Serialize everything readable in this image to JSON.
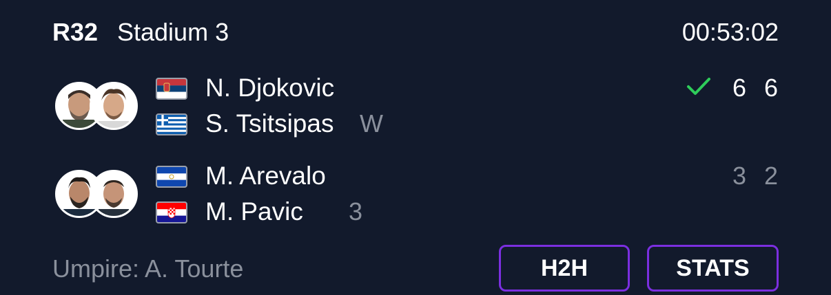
{
  "match": {
    "round": "R32",
    "court": "Stadium 3",
    "duration": "00:53:02"
  },
  "teams": [
    {
      "players": [
        {
          "name": "N. Djokovic",
          "flag_icon": "serbia-flag-icon"
        },
        {
          "name": "S. Tsitsipas",
          "flag_icon": "greece-flag-icon",
          "seed": "W"
        }
      ],
      "sets": [
        "6",
        "6"
      ],
      "winner": true
    },
    {
      "players": [
        {
          "name": "M. Arevalo",
          "flag_icon": "el-salvador-flag-icon"
        },
        {
          "name": "M. Pavic",
          "flag_icon": "croatia-flag-icon",
          "seed": "3"
        }
      ],
      "sets": [
        "3",
        "2"
      ],
      "winner": false
    }
  ],
  "footer": {
    "umpire": "Umpire: A. Tourte",
    "h2h_label": "H2H",
    "stats_label": "STATS"
  },
  "colors": {
    "background": "#121a2c",
    "accent": "#7b2fe0",
    "winner_check": "#2ecc5a",
    "muted_text": "#8a909c"
  }
}
